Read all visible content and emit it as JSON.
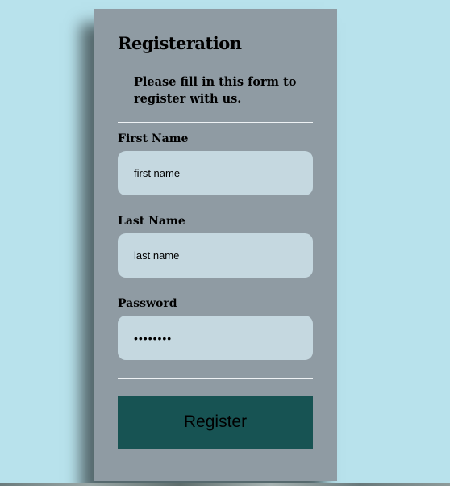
{
  "form": {
    "title": "Registeration",
    "subtitle": "Please fill in this form to register with us.",
    "fields": [
      {
        "label": "First Name",
        "placeholder": "first name",
        "value": ""
      },
      {
        "label": "Last Name",
        "placeholder": "last name",
        "value": ""
      },
      {
        "label": "Password",
        "placeholder": "",
        "value": "••••••••"
      }
    ],
    "submit_label": "Register"
  },
  "colors": {
    "page_background": "#b8e2ec",
    "card_background": "#8f9ba3",
    "input_background": "#c5d8e0",
    "button_background": "#175353"
  }
}
